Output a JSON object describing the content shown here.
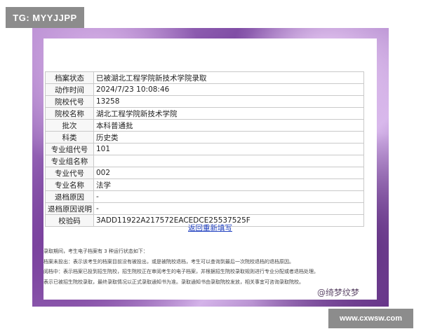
{
  "watermarks": {
    "top_left": "TG: MYYJJPP",
    "bottom_right": "www.cxwsw.com",
    "signature": "@绮梦纹梦"
  },
  "rows": [
    {
      "label": "档案状态",
      "value": "已被湖北工程学院新技术学院录取"
    },
    {
      "label": "动作时间",
      "value": "2024/7/23 10:08:46"
    },
    {
      "label": "院校代号",
      "value": "13258"
    },
    {
      "label": "院校名称",
      "value": "湖北工程学院新技术学院"
    },
    {
      "label": "批次",
      "value": "本科普通批"
    },
    {
      "label": "科类",
      "value": "历史类"
    },
    {
      "label": "专业组代号",
      "value": "101"
    },
    {
      "label": "专业组名称",
      "value": ""
    },
    {
      "label": "专业代号",
      "value": "002"
    },
    {
      "label": "专业名称",
      "value": "法学"
    },
    {
      "label": "退档原因",
      "value": "-"
    },
    {
      "label": "退档原因说明",
      "value": "-"
    },
    {
      "label": "校验码",
      "value": "3ADD11922A217572EACEDCE25537525F"
    }
  ],
  "reselect_link": "返回重新填写",
  "notes": [
    "录取期间，考生电子档案有 3 种运行状态如下：",
    "档案未投出：表示该考生的档案目前没有被投出，或是被院校退档，考生可以查询到最后一次院校退档的退档原因。",
    "阅档中：表示档案已投到招生院校，招生院校正在审阅考生的电子档案，并根据招生院校录取规则进行专业分配或者退档处理。",
    "表示已被招生院校录取，最终录取情况以正式录取通知书为准。录取通知书由录取院校发放，相关事宜可咨询录取院校。"
  ]
}
